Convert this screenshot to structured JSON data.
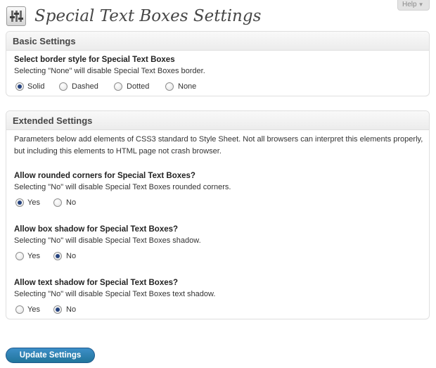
{
  "page": {
    "title": "Special Text Boxes Settings",
    "help_label": "Help",
    "icon": "settings-sliders-icon"
  },
  "basic": {
    "heading": "Basic Settings",
    "border_style": {
      "label": "Select border style for Special Text Boxes",
      "description": "Selecting \"None\" will disable Special Text Boxes border.",
      "options": [
        "Solid",
        "Dashed",
        "Dotted",
        "None"
      ],
      "selected": "Solid"
    }
  },
  "extended": {
    "heading": "Extended Settings",
    "intro": "Parameters below add elements of CSS3 standard to Style Sheet. Not all browsers can interpret this elements properly, but including this elements to HTML page not crash browser.",
    "rounded_corners": {
      "label": "Allow rounded corners for Special Text Boxes?",
      "description": "Selecting \"No\" will disable Special Text Boxes rounded corners.",
      "options": [
        "Yes",
        "No"
      ],
      "selected": "Yes"
    },
    "box_shadow": {
      "label": "Allow box shadow for Special Text Boxes?",
      "description": "Selecting \"No\" will disable Special Text Boxes shadow.",
      "options": [
        "Yes",
        "No"
      ],
      "selected": "No"
    },
    "text_shadow": {
      "label": "Allow text shadow for Special Text Boxes?",
      "description": "Selecting \"No\" will disable Special Text Boxes text shadow.",
      "options": [
        "Yes",
        "No"
      ],
      "selected": "No"
    }
  },
  "update_button_label": "Update Settings",
  "colors": {
    "button": "#21759b",
    "radio_dot": "#24427e",
    "box_border": "#dfdfdf"
  }
}
